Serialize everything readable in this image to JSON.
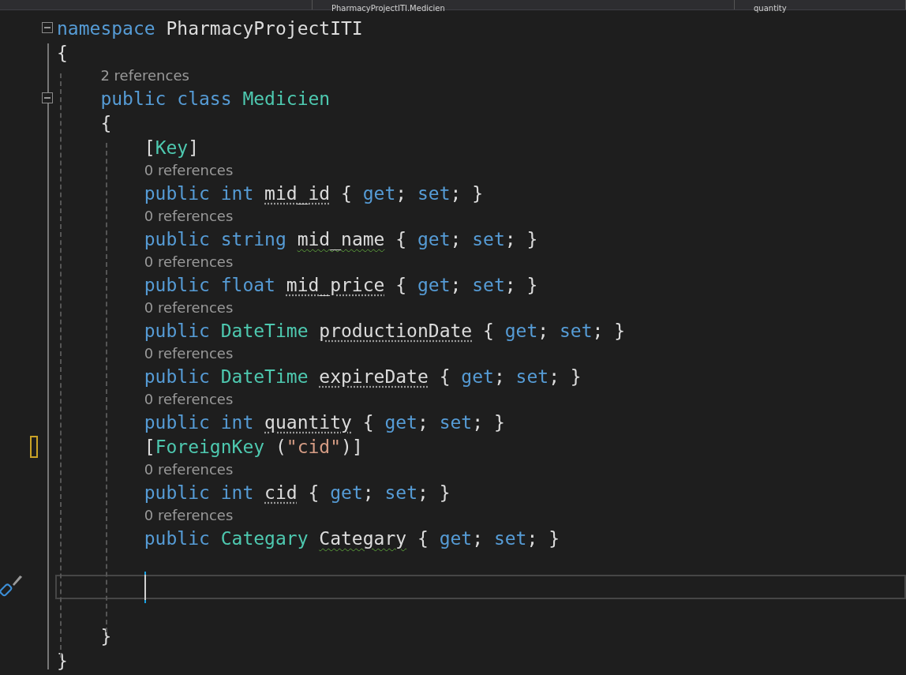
{
  "nav_bar": {
    "type_dropdown": "PharmacyProjectITI.Medicien",
    "member_dropdown": "quantity"
  },
  "lines": [
    {
      "kind": "code",
      "expanded": true,
      "edited": false,
      "tokens": [
        {
          "text": "namespace",
          "kind": "keyword"
        },
        {
          "text": " PharmacyProjectITI",
          "kind": "plain"
        }
      ]
    },
    {
      "kind": "code",
      "edited": false,
      "tokens": [
        {
          "text": "{",
          "kind": "plain"
        }
      ]
    },
    {
      "kind": "block",
      "children": [
        {
          "kind": "lens",
          "text": "2 references"
        },
        {
          "kind": "code",
          "expanded": true,
          "edited": false,
          "tokens": [
            {
              "text": "public class ",
              "kind": "keyword"
            },
            {
              "text": "Medicien",
              "kind": "type"
            }
          ]
        },
        {
          "kind": "code",
          "edited": false,
          "tokens": [
            {
              "text": "{",
              "kind": "plain"
            }
          ]
        },
        {
          "kind": "block",
          "children": [
            {
              "kind": "code",
              "edited": false,
              "tokens": [
                {
                  "text": "[",
                  "kind": "plain"
                },
                {
                  "text": "Key",
                  "kind": "type"
                },
                {
                  "text": "]",
                  "kind": "plain"
                }
              ]
            },
            {
              "kind": "lens",
              "text": "0 references"
            },
            {
              "kind": "code",
              "edited": false,
              "tokens": [
                {
                  "text": "public int ",
                  "kind": "keyword"
                },
                {
                  "text": "mid_id",
                  "kind": "hint"
                },
                {
                  "text": " { ",
                  "kind": "plain"
                },
                {
                  "text": "get",
                  "kind": "keyword"
                },
                {
                  "text": "; ",
                  "kind": "plain"
                },
                {
                  "text": "set",
                  "kind": "keyword"
                },
                {
                  "text": "; }",
                  "kind": "plain"
                }
              ]
            },
            {
              "kind": "lens",
              "text": "0 references"
            },
            {
              "kind": "code",
              "edited": false,
              "tokens": [
                {
                  "text": "public string ",
                  "kind": "keyword"
                },
                {
                  "text": "mid_name",
                  "kind": "warning"
                },
                {
                  "text": " { ",
                  "kind": "plain"
                },
                {
                  "text": "get",
                  "kind": "keyword"
                },
                {
                  "text": "; ",
                  "kind": "plain"
                },
                {
                  "text": "set",
                  "kind": "keyword"
                },
                {
                  "text": "; }",
                  "kind": "plain"
                }
              ]
            },
            {
              "kind": "lens",
              "text": "0 references"
            },
            {
              "kind": "code",
              "edited": false,
              "tokens": [
                {
                  "text": "public float ",
                  "kind": "keyword"
                },
                {
                  "text": "mid_price",
                  "kind": "hint"
                },
                {
                  "text": " { ",
                  "kind": "plain"
                },
                {
                  "text": "get",
                  "kind": "keyword"
                },
                {
                  "text": "; ",
                  "kind": "plain"
                },
                {
                  "text": "set",
                  "kind": "keyword"
                },
                {
                  "text": "; }",
                  "kind": "plain"
                }
              ]
            },
            {
              "kind": "lens",
              "text": "0 references"
            },
            {
              "kind": "code",
              "edited": false,
              "tokens": [
                {
                  "text": "public ",
                  "kind": "keyword"
                },
                {
                  "text": "DateTime ",
                  "kind": "type"
                },
                {
                  "text": "productionDate",
                  "kind": "hint"
                },
                {
                  "text": " { ",
                  "kind": "plain"
                },
                {
                  "text": "get",
                  "kind": "keyword"
                },
                {
                  "text": "; ",
                  "kind": "plain"
                },
                {
                  "text": "set",
                  "kind": "keyword"
                },
                {
                  "text": "; }",
                  "kind": "plain"
                }
              ]
            },
            {
              "kind": "lens",
              "text": "0 references"
            },
            {
              "kind": "code",
              "edited": false,
              "tokens": [
                {
                  "text": "public ",
                  "kind": "keyword"
                },
                {
                  "text": "DateTime ",
                  "kind": "type"
                },
                {
                  "text": "expireDate",
                  "kind": "hint"
                },
                {
                  "text": " { ",
                  "kind": "plain"
                },
                {
                  "text": "get",
                  "kind": "keyword"
                },
                {
                  "text": "; ",
                  "kind": "plain"
                },
                {
                  "text": "set",
                  "kind": "keyword"
                },
                {
                  "text": "; }",
                  "kind": "plain"
                }
              ]
            },
            {
              "kind": "lens",
              "text": "0 references"
            },
            {
              "kind": "code",
              "edited": false,
              "tokens": [
                {
                  "text": "public int ",
                  "kind": "keyword"
                },
                {
                  "text": "quantity",
                  "kind": "hint"
                },
                {
                  "text": " { ",
                  "kind": "plain"
                },
                {
                  "text": "get",
                  "kind": "keyword"
                },
                {
                  "text": "; ",
                  "kind": "plain"
                },
                {
                  "text": "set",
                  "kind": "keyword"
                },
                {
                  "text": "; }",
                  "kind": "plain"
                }
              ]
            },
            {
              "kind": "code",
              "edited": true,
              "tokens": [
                {
                  "text": "[",
                  "kind": "plain"
                },
                {
                  "text": "ForeignKey",
                  "kind": "type"
                },
                {
                  "text": " (",
                  "kind": "plain"
                },
                {
                  "text": "\"cid\"",
                  "kind": "string"
                },
                {
                  "text": ")]",
                  "kind": "plain"
                }
              ]
            },
            {
              "kind": "lens",
              "text": "0 references"
            },
            {
              "kind": "code",
              "edited": false,
              "tokens": [
                {
                  "text": "public int ",
                  "kind": "keyword"
                },
                {
                  "text": "cid",
                  "kind": "hint"
                },
                {
                  "text": " { ",
                  "kind": "plain"
                },
                {
                  "text": "get",
                  "kind": "keyword"
                },
                {
                  "text": "; ",
                  "kind": "plain"
                },
                {
                  "text": "set",
                  "kind": "keyword"
                },
                {
                  "text": "; }",
                  "kind": "plain"
                }
              ]
            },
            {
              "kind": "lens",
              "text": "0 references"
            },
            {
              "kind": "code",
              "edited": false,
              "tokens": [
                {
                  "text": "public ",
                  "kind": "keyword"
                },
                {
                  "text": "Categary ",
                  "kind": "type"
                },
                {
                  "text": "Categary",
                  "kind": "warning"
                },
                {
                  "text": " { ",
                  "kind": "plain"
                },
                {
                  "text": "get",
                  "kind": "keyword"
                },
                {
                  "text": "; ",
                  "kind": "plain"
                },
                {
                  "text": "set",
                  "kind": "keyword"
                },
                {
                  "text": "; }",
                  "kind": "plain"
                }
              ]
            },
            {
              "kind": "blank",
              "current": false
            },
            {
              "kind": "blank",
              "current": true
            },
            {
              "kind": "blank",
              "current": false
            }
          ]
        },
        {
          "kind": "code",
          "edited": false,
          "tokens": [
            {
              "text": "}",
              "kind": "plain"
            }
          ]
        }
      ]
    },
    {
      "kind": "code",
      "edited": false,
      "tokens": [
        {
          "text": "}",
          "kind": "plain"
        }
      ]
    }
  ]
}
